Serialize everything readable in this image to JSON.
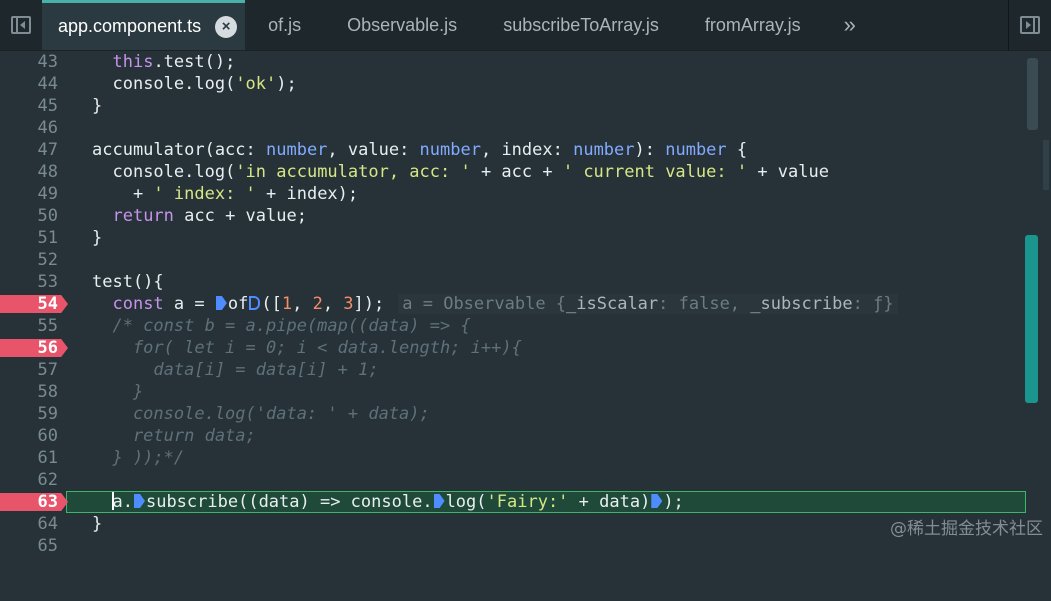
{
  "tabs": [
    {
      "label": "app.component.ts",
      "active": true
    },
    {
      "label": "of.js"
    },
    {
      "label": "Observable.js"
    },
    {
      "label": "subscribeToArray.js"
    },
    {
      "label": "fromArray.js"
    }
  ],
  "tab_close_glyph": "×",
  "tab_overflow_glyph": "»",
  "line_numbers": [
    "43",
    "44",
    "45",
    "46",
    "47",
    "48",
    "49",
    "50",
    "51",
    "52",
    "53",
    "54",
    "55",
    "56",
    "57",
    "58",
    "59",
    "60",
    "61",
    "62",
    "63",
    "64",
    "65"
  ],
  "breakpoint_lines": [
    "54",
    "56",
    "63"
  ],
  "code": {
    "l43": {
      "indent": "  ",
      "a": "this",
      "b": ".test();"
    },
    "l44": {
      "indent": "  ",
      "a": "console.log(",
      "s": "'ok'",
      "b": ");"
    },
    "l45": "}",
    "l47": {
      "a": "accumulator(acc: ",
      "t1": "number",
      "b": ", value: ",
      "t2": "number",
      "c": ", index: ",
      "t3": "number",
      "d": "): ",
      "t4": "number",
      "e": " {"
    },
    "l48": {
      "indent": "  ",
      "a": "console.log(",
      "s1": "'in accumulator, acc: '",
      "b": " + acc + ",
      "s2": "' current value: '",
      "c": " + value"
    },
    "l49": {
      "indent": "    + ",
      "s": "' index: '",
      "b": " + index);"
    },
    "l50": {
      "indent": "  ",
      "kw": "return",
      "b": " acc + value;"
    },
    "l51": "}",
    "l53": "test(){",
    "l54": {
      "indent": "  ",
      "kw": "const",
      "a": " a = ",
      "fn": "of",
      "b": "([",
      "n1": "1",
      "c": ", ",
      "n2": "2",
      "d": ", ",
      "n3": "3",
      "e": "]);"
    },
    "l54_inline": {
      "a": "a = Observable {",
      "k1": "_isScalar",
      "b": ": false, ",
      "k2": "_subscribe",
      "c": ": ƒ}"
    },
    "l55": "  /* const b = a.pipe(map((data) => {",
    "l56": "    for( let i = 0; i < data.length; i++){",
    "l57": "      data[i] = data[i] + 1;",
    "l58": "    }",
    "l59": "    console.log('data: ' + data);",
    "l60": "    return data;",
    "l61": "  } ));*/",
    "l63": {
      "indent": "  ",
      "a": "a.",
      "fn1": "subscribe",
      "b": "((data) => console.",
      "fn2": "log",
      "c": "(",
      "s": "'Fairy:'",
      "d": " + data)",
      "e": ");"
    },
    "l64": "}"
  },
  "watermark": "@稀土掘金技术社区",
  "colors": {
    "accent": "#49b2a8",
    "breakpoint": "#e8546a",
    "keyword": "#c792ea",
    "string": "#d6e685",
    "type": "#82aaff",
    "number": "#f78c6c"
  }
}
